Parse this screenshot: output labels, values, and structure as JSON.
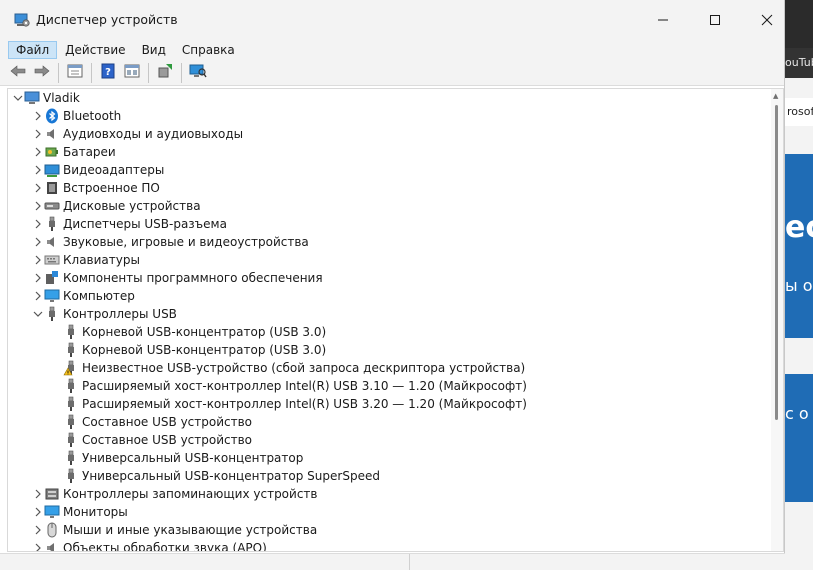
{
  "window": {
    "title": "Диспетчер устройств"
  },
  "menu": [
    {
      "label": "Файл",
      "active": true
    },
    {
      "label": "Действие",
      "active": false
    },
    {
      "label": "Вид",
      "active": false
    },
    {
      "label": "Справка",
      "active": false
    }
  ],
  "toolbar": [
    {
      "name": "back-icon",
      "glyph": "⇦"
    },
    {
      "name": "forward-icon",
      "glyph": "⇨"
    },
    {
      "sep": true
    },
    {
      "name": "properties-icon",
      "glyph": "▤"
    },
    {
      "sep": true
    },
    {
      "name": "help-icon",
      "glyph": "?"
    },
    {
      "name": "view-icon",
      "glyph": "▦"
    },
    {
      "sep": true
    },
    {
      "name": "update-driver-icon",
      "glyph": "⟳"
    },
    {
      "sep": true
    },
    {
      "name": "scan-hardware-icon",
      "glyph": "🖵"
    }
  ],
  "tree": {
    "root": {
      "label": "Vladik",
      "icon": "computer-icon"
    },
    "categories": [
      {
        "label": "Bluetooth",
        "icon": "bluetooth-icon",
        "expanded": false
      },
      {
        "label": "Аудиовходы и аудиовыходы",
        "icon": "speaker-icon",
        "expanded": false
      },
      {
        "label": "Батареи",
        "icon": "battery-icon",
        "expanded": false
      },
      {
        "label": "Видеоадаптеры",
        "icon": "display-adapter-icon",
        "expanded": false
      },
      {
        "label": "Встроенное ПО",
        "icon": "firmware-icon",
        "expanded": false
      },
      {
        "label": "Дисковые устройства",
        "icon": "disk-icon",
        "expanded": false
      },
      {
        "label": "Диспетчеры USB-разъема",
        "icon": "usb-plug-icon",
        "expanded": false
      },
      {
        "label": "Звуковые, игровые и видеоустройства",
        "icon": "speaker-icon",
        "expanded": false
      },
      {
        "label": "Клавиатуры",
        "icon": "keyboard-icon",
        "expanded": false
      },
      {
        "label": "Компоненты программного обеспечения",
        "icon": "software-component-icon",
        "expanded": false
      },
      {
        "label": "Компьютер",
        "icon": "monitor-icon",
        "expanded": false
      },
      {
        "label": "Контроллеры USB",
        "icon": "usb-plug-icon",
        "expanded": true,
        "children": [
          {
            "label": "Корневой USB-концентратор (USB 3.0)",
            "icon": "usb-plug-icon"
          },
          {
            "label": "Корневой USB-концентратор (USB 3.0)",
            "icon": "usb-plug-icon"
          },
          {
            "label": "Неизвестное USB-устройство (сбой запроса дескриптора устройства)",
            "icon": "usb-warning-icon"
          },
          {
            "label": "Расширяемый хост-контроллер Intel(R) USB 3.10 — 1.20 (Майкрософт)",
            "icon": "usb-plug-icon"
          },
          {
            "label": "Расширяемый хост-контроллер Intel(R) USB 3.20 — 1.20 (Майкрософт)",
            "icon": "usb-plug-icon"
          },
          {
            "label": "Составное USB устройство",
            "icon": "usb-plug-icon"
          },
          {
            "label": "Составное USB устройство",
            "icon": "usb-plug-icon"
          },
          {
            "label": "Универсальный USB-концентратор",
            "icon": "usb-plug-icon"
          },
          {
            "label": "Универсальный USB-концентратор SuperSpeed",
            "icon": "usb-plug-icon"
          }
        ]
      },
      {
        "label": "Контроллеры запоминающих устройств",
        "icon": "storage-controller-icon",
        "expanded": false
      },
      {
        "label": "Мониторы",
        "icon": "monitor-icon",
        "expanded": false
      },
      {
        "label": "Мыши и иные указывающие устройства",
        "icon": "mouse-icon",
        "expanded": false
      },
      {
        "label": "Объекты обработки звука (APO)",
        "icon": "speaker-icon",
        "expanded": false
      }
    ]
  },
  "background_window": {
    "tab_text": "ouTub",
    "address_text": "rosof",
    "banner_text_1": "ec",
    "banner_text_2": "ы о",
    "banner_text_3": "с о"
  }
}
